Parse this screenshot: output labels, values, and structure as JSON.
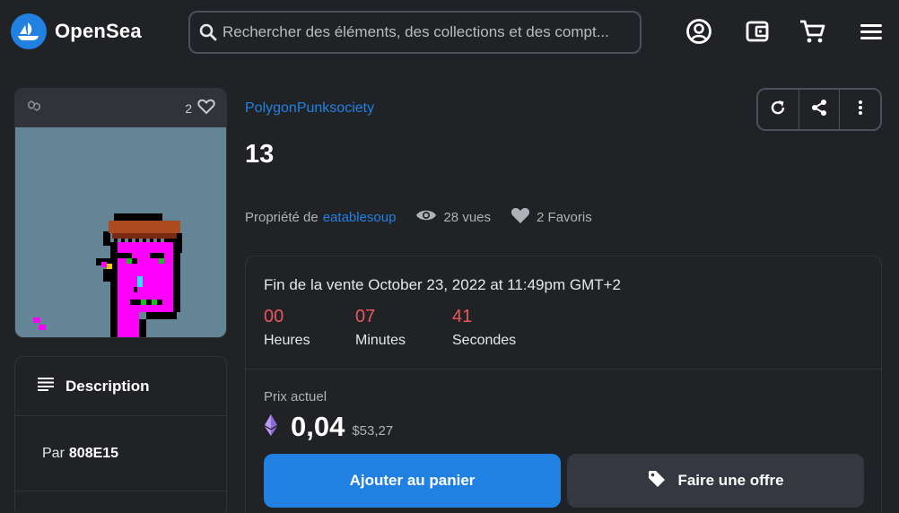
{
  "header": {
    "brand": "OpenSea",
    "search_placeholder": "Rechercher des éléments, des collections et des compt..."
  },
  "card": {
    "favorites_count": "2"
  },
  "description": {
    "title": "Description",
    "by_label": "Par",
    "creator": "808E15"
  },
  "item": {
    "collection": "PolygonPunksociety",
    "name": "13",
    "owned_by_label": "Propriété de",
    "owner": "eatablesoup",
    "views": "28 vues",
    "favorites": "2 Favoris"
  },
  "sale": {
    "end_text": "Fin de la vente October 23, 2022 at 11:49pm GMT+2",
    "countdown": [
      {
        "value": "00",
        "label": "Heures"
      },
      {
        "value": "07",
        "label": "Minutes"
      },
      {
        "value": "41",
        "label": "Secondes"
      }
    ],
    "price_label": "Prix actuel",
    "price": "0,04",
    "price_usd": "$53,27",
    "add_to_cart": "Ajouter au panier",
    "make_offer": "Faire une offre"
  },
  "colors": {
    "accent": "#2081e2",
    "background": "#202225",
    "countdown": "#eb5757",
    "punk_skin": "#ff00ff",
    "punk_bg": "#638596"
  }
}
